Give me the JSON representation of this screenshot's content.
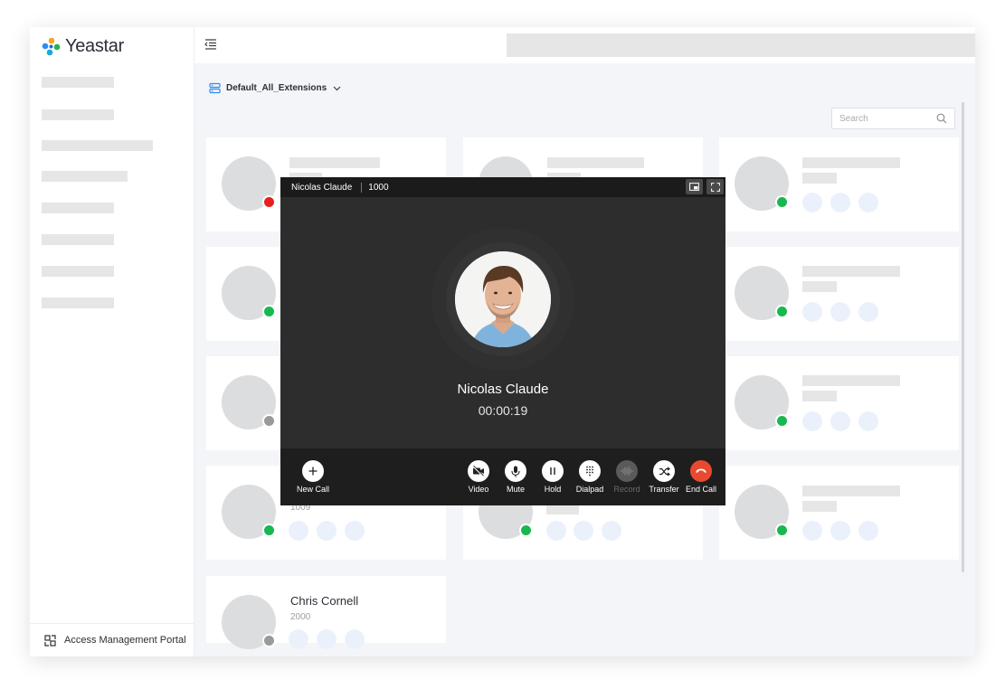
{
  "app": {
    "brand": "Yeastar"
  },
  "sidebar": {
    "footer_label": "Access Management Portal"
  },
  "toolbar": {
    "extension_group": "Default_All_Extensions",
    "search_placeholder": "Search"
  },
  "contacts": {
    "partial_ext": "1009",
    "last_card": {
      "name": "Chris Cornell",
      "ext": "2000"
    }
  },
  "call": {
    "caller_name": "Nicolas Claude",
    "caller_ext": "1000",
    "duration": "00:00:19",
    "controls": {
      "new_call": "New Call",
      "video": "Video",
      "mute": "Mute",
      "hold": "Hold",
      "dialpad": "Dialpad",
      "record": "Record",
      "transfer": "Transfer",
      "end_call": "End Call"
    }
  },
  "colors": {
    "status_online": "#17b850",
    "status_busy": "#e8201c",
    "status_offline": "#9a9a9a",
    "end_call": "#e8492f",
    "brand_blue": "#2d8cf0"
  }
}
